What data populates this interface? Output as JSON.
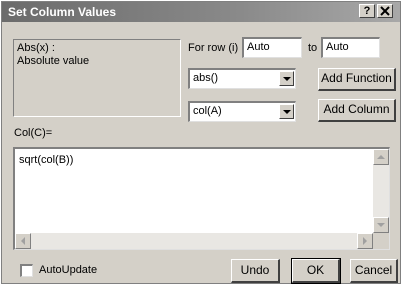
{
  "window": {
    "title": "Set Column Values",
    "help_label": "?",
    "close_label": "X"
  },
  "description": {
    "name": "Abs(x) :",
    "text": "Absolute value"
  },
  "row_range": {
    "for_row_label": "For row (i)",
    "from_value": "Auto",
    "to_label": "to",
    "to_value": "Auto"
  },
  "function_select": {
    "value": "abs()",
    "icon": "chevron-down-icon"
  },
  "column_select": {
    "value": "col(A)",
    "icon": "chevron-down-icon"
  },
  "buttons": {
    "add_function": "Add Function",
    "add_column": "Add Column",
    "undo": "Undo",
    "ok": "OK",
    "cancel": "Cancel"
  },
  "expression": {
    "target_label": "Col(C)=",
    "formula": "sqrt(col(B))"
  },
  "autoupdate": {
    "label": "AutoUpdate",
    "checked": false
  }
}
